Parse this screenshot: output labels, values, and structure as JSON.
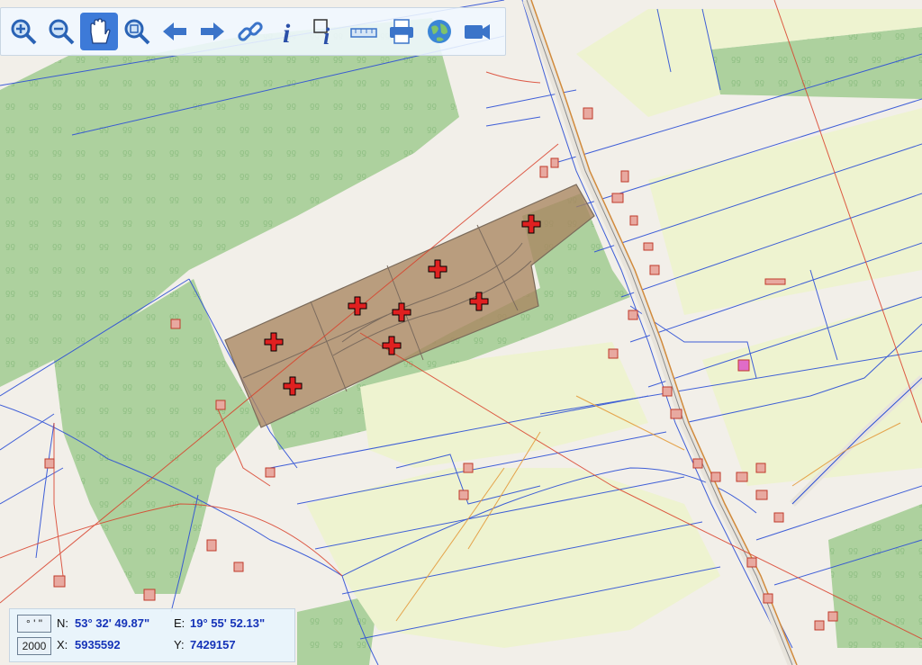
{
  "toolbar": {
    "tools": [
      {
        "icon": "zoom-in-icon"
      },
      {
        "icon": "zoom-out-icon"
      },
      {
        "icon": "pan-hand-icon",
        "active": true
      },
      {
        "icon": "zoom-extent-icon"
      },
      {
        "icon": "arrow-back-icon"
      },
      {
        "icon": "arrow-forward-icon"
      },
      {
        "icon": "link-icon"
      },
      {
        "icon": "info-icon"
      },
      {
        "icon": "info-area-icon"
      },
      {
        "icon": "measure-icon"
      },
      {
        "icon": "print-icon"
      },
      {
        "icon": "globe-icon"
      },
      {
        "icon": "camera-icon"
      }
    ]
  },
  "coords": {
    "format_button": "° ' \"",
    "scale_button": "2000",
    "n_label": "N:",
    "n_value": "53° 32' 49.87\"",
    "e_label": "E:",
    "e_value": "19° 55' 52.13\"",
    "x_label": "X:",
    "x_value": "5935592",
    "y_label": "Y:",
    "y_value": "7429157"
  },
  "colors": {
    "forest": "#add19e",
    "background": "#f2efe9",
    "meadow": "#eef3d0",
    "parcel_line": "#2c4fd6",
    "highlight": "#a98560",
    "utility_red": "#d9402a",
    "building": "#e8a9a0"
  }
}
